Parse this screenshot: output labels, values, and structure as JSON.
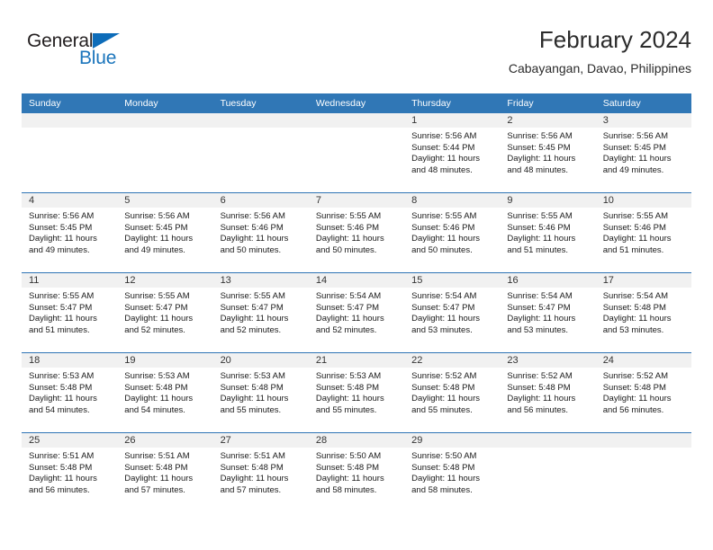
{
  "brand": {
    "logo_text_primary": "General",
    "logo_text_secondary": "Blue",
    "logo_flag_icon": "triangle-flag-icon",
    "primary_color": "#3077b6",
    "logo_blue": "#1b75bc",
    "header_text_color": "#ffffff",
    "daynum_band_color": "#f1f1f1",
    "week_divider_color": "#2f75b5"
  },
  "header": {
    "title": "February 2024",
    "subtitle": "Cabayangan, Davao, Philippines"
  },
  "calendar": {
    "weekday_headers": [
      "Sunday",
      "Monday",
      "Tuesday",
      "Wednesday",
      "Thursday",
      "Friday",
      "Saturday"
    ],
    "weeks": [
      [
        {
          "day": "",
          "sunrise": "",
          "sunset": "",
          "daylight_line1": "",
          "daylight_line2": ""
        },
        {
          "day": "",
          "sunrise": "",
          "sunset": "",
          "daylight_line1": "",
          "daylight_line2": ""
        },
        {
          "day": "",
          "sunrise": "",
          "sunset": "",
          "daylight_line1": "",
          "daylight_line2": ""
        },
        {
          "day": "",
          "sunrise": "",
          "sunset": "",
          "daylight_line1": "",
          "daylight_line2": ""
        },
        {
          "day": "1",
          "sunrise": "Sunrise: 5:56 AM",
          "sunset": "Sunset: 5:44 PM",
          "daylight_line1": "Daylight: 11 hours",
          "daylight_line2": "and 48 minutes."
        },
        {
          "day": "2",
          "sunrise": "Sunrise: 5:56 AM",
          "sunset": "Sunset: 5:45 PM",
          "daylight_line1": "Daylight: 11 hours",
          "daylight_line2": "and 48 minutes."
        },
        {
          "day": "3",
          "sunrise": "Sunrise: 5:56 AM",
          "sunset": "Sunset: 5:45 PM",
          "daylight_line1": "Daylight: 11 hours",
          "daylight_line2": "and 49 minutes."
        }
      ],
      [
        {
          "day": "4",
          "sunrise": "Sunrise: 5:56 AM",
          "sunset": "Sunset: 5:45 PM",
          "daylight_line1": "Daylight: 11 hours",
          "daylight_line2": "and 49 minutes."
        },
        {
          "day": "5",
          "sunrise": "Sunrise: 5:56 AM",
          "sunset": "Sunset: 5:45 PM",
          "daylight_line1": "Daylight: 11 hours",
          "daylight_line2": "and 49 minutes."
        },
        {
          "day": "6",
          "sunrise": "Sunrise: 5:56 AM",
          "sunset": "Sunset: 5:46 PM",
          "daylight_line1": "Daylight: 11 hours",
          "daylight_line2": "and 50 minutes."
        },
        {
          "day": "7",
          "sunrise": "Sunrise: 5:55 AM",
          "sunset": "Sunset: 5:46 PM",
          "daylight_line1": "Daylight: 11 hours",
          "daylight_line2": "and 50 minutes."
        },
        {
          "day": "8",
          "sunrise": "Sunrise: 5:55 AM",
          "sunset": "Sunset: 5:46 PM",
          "daylight_line1": "Daylight: 11 hours",
          "daylight_line2": "and 50 minutes."
        },
        {
          "day": "9",
          "sunrise": "Sunrise: 5:55 AM",
          "sunset": "Sunset: 5:46 PM",
          "daylight_line1": "Daylight: 11 hours",
          "daylight_line2": "and 51 minutes."
        },
        {
          "day": "10",
          "sunrise": "Sunrise: 5:55 AM",
          "sunset": "Sunset: 5:46 PM",
          "daylight_line1": "Daylight: 11 hours",
          "daylight_line2": "and 51 minutes."
        }
      ],
      [
        {
          "day": "11",
          "sunrise": "Sunrise: 5:55 AM",
          "sunset": "Sunset: 5:47 PM",
          "daylight_line1": "Daylight: 11 hours",
          "daylight_line2": "and 51 minutes."
        },
        {
          "day": "12",
          "sunrise": "Sunrise: 5:55 AM",
          "sunset": "Sunset: 5:47 PM",
          "daylight_line1": "Daylight: 11 hours",
          "daylight_line2": "and 52 minutes."
        },
        {
          "day": "13",
          "sunrise": "Sunrise: 5:55 AM",
          "sunset": "Sunset: 5:47 PM",
          "daylight_line1": "Daylight: 11 hours",
          "daylight_line2": "and 52 minutes."
        },
        {
          "day": "14",
          "sunrise": "Sunrise: 5:54 AM",
          "sunset": "Sunset: 5:47 PM",
          "daylight_line1": "Daylight: 11 hours",
          "daylight_line2": "and 52 minutes."
        },
        {
          "day": "15",
          "sunrise": "Sunrise: 5:54 AM",
          "sunset": "Sunset: 5:47 PM",
          "daylight_line1": "Daylight: 11 hours",
          "daylight_line2": "and 53 minutes."
        },
        {
          "day": "16",
          "sunrise": "Sunrise: 5:54 AM",
          "sunset": "Sunset: 5:47 PM",
          "daylight_line1": "Daylight: 11 hours",
          "daylight_line2": "and 53 minutes."
        },
        {
          "day": "17",
          "sunrise": "Sunrise: 5:54 AM",
          "sunset": "Sunset: 5:48 PM",
          "daylight_line1": "Daylight: 11 hours",
          "daylight_line2": "and 53 minutes."
        }
      ],
      [
        {
          "day": "18",
          "sunrise": "Sunrise: 5:53 AM",
          "sunset": "Sunset: 5:48 PM",
          "daylight_line1": "Daylight: 11 hours",
          "daylight_line2": "and 54 minutes."
        },
        {
          "day": "19",
          "sunrise": "Sunrise: 5:53 AM",
          "sunset": "Sunset: 5:48 PM",
          "daylight_line1": "Daylight: 11 hours",
          "daylight_line2": "and 54 minutes."
        },
        {
          "day": "20",
          "sunrise": "Sunrise: 5:53 AM",
          "sunset": "Sunset: 5:48 PM",
          "daylight_line1": "Daylight: 11 hours",
          "daylight_line2": "and 55 minutes."
        },
        {
          "day": "21",
          "sunrise": "Sunrise: 5:53 AM",
          "sunset": "Sunset: 5:48 PM",
          "daylight_line1": "Daylight: 11 hours",
          "daylight_line2": "and 55 minutes."
        },
        {
          "day": "22",
          "sunrise": "Sunrise: 5:52 AM",
          "sunset": "Sunset: 5:48 PM",
          "daylight_line1": "Daylight: 11 hours",
          "daylight_line2": "and 55 minutes."
        },
        {
          "day": "23",
          "sunrise": "Sunrise: 5:52 AM",
          "sunset": "Sunset: 5:48 PM",
          "daylight_line1": "Daylight: 11 hours",
          "daylight_line2": "and 56 minutes."
        },
        {
          "day": "24",
          "sunrise": "Sunrise: 5:52 AM",
          "sunset": "Sunset: 5:48 PM",
          "daylight_line1": "Daylight: 11 hours",
          "daylight_line2": "and 56 minutes."
        }
      ],
      [
        {
          "day": "25",
          "sunrise": "Sunrise: 5:51 AM",
          "sunset": "Sunset: 5:48 PM",
          "daylight_line1": "Daylight: 11 hours",
          "daylight_line2": "and 56 minutes."
        },
        {
          "day": "26",
          "sunrise": "Sunrise: 5:51 AM",
          "sunset": "Sunset: 5:48 PM",
          "daylight_line1": "Daylight: 11 hours",
          "daylight_line2": "and 57 minutes."
        },
        {
          "day": "27",
          "sunrise": "Sunrise: 5:51 AM",
          "sunset": "Sunset: 5:48 PM",
          "daylight_line1": "Daylight: 11 hours",
          "daylight_line2": "and 57 minutes."
        },
        {
          "day": "28",
          "sunrise": "Sunrise: 5:50 AM",
          "sunset": "Sunset: 5:48 PM",
          "daylight_line1": "Daylight: 11 hours",
          "daylight_line2": "and 58 minutes."
        },
        {
          "day": "29",
          "sunrise": "Sunrise: 5:50 AM",
          "sunset": "Sunset: 5:48 PM",
          "daylight_line1": "Daylight: 11 hours",
          "daylight_line2": "and 58 minutes."
        },
        {
          "day": "",
          "sunrise": "",
          "sunset": "",
          "daylight_line1": "",
          "daylight_line2": ""
        },
        {
          "day": "",
          "sunrise": "",
          "sunset": "",
          "daylight_line1": "",
          "daylight_line2": ""
        }
      ]
    ]
  }
}
